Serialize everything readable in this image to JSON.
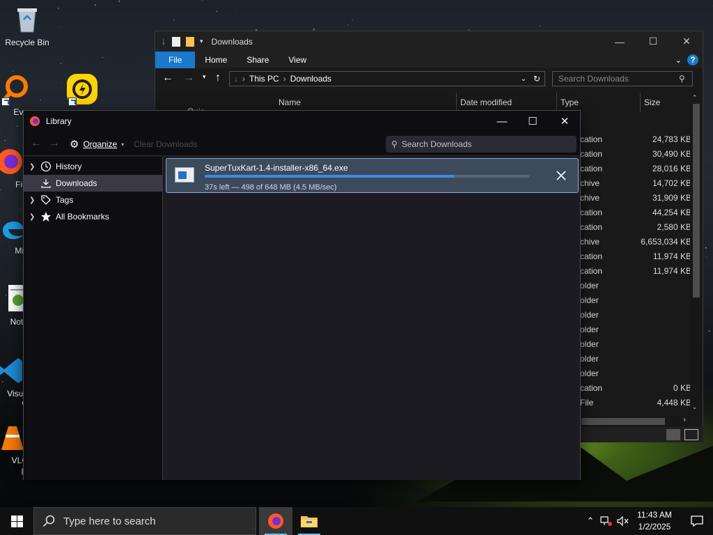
{
  "desktop": {
    "icons": [
      {
        "label": "Recycle Bin"
      },
      {
        "label": "Ever"
      },
      {
        "label": ""
      },
      {
        "label": "Fir"
      },
      {
        "label": "Mic\nE"
      },
      {
        "label": "Note"
      },
      {
        "label": "Visua\nC"
      },
      {
        "label": "VLC\npl"
      }
    ]
  },
  "explorer": {
    "title": "Downloads",
    "ribbon_tabs": [
      "File",
      "Home",
      "Share",
      "View"
    ],
    "breadcrumb": [
      "This PC",
      "Downloads"
    ],
    "search_placeholder": "Search Downloads",
    "columns": {
      "name": "Name",
      "date": "Date modified",
      "type": "Type",
      "size": "Size"
    },
    "partial_row": "Quic",
    "rows": [
      {
        "type": "cation",
        "size": "24,783 KB"
      },
      {
        "type": "cation",
        "size": "30,490 KB"
      },
      {
        "type": "cation",
        "size": "28,016 KB"
      },
      {
        "type": "chive",
        "size": "14,702 KB"
      },
      {
        "type": "chive",
        "size": "31,909 KB"
      },
      {
        "type": "cation",
        "size": "44,254 KB"
      },
      {
        "type": "cation",
        "size": "2,580 KB"
      },
      {
        "type": "chive",
        "size": "6,653,034 KB"
      },
      {
        "type": "cation",
        "size": "11,974 KB"
      },
      {
        "type": "cation",
        "size": "11,974 KB"
      },
      {
        "type": "older",
        "size": ""
      },
      {
        "type": "older",
        "size": ""
      },
      {
        "type": "older",
        "size": ""
      },
      {
        "type": "older",
        "size": ""
      },
      {
        "type": "older",
        "size": ""
      },
      {
        "type": "older",
        "size": ""
      },
      {
        "type": "older",
        "size": ""
      },
      {
        "type": "cation",
        "size": "0 KB"
      },
      {
        "type": "File",
        "size": "4,448 KB"
      }
    ]
  },
  "library": {
    "title": "Library",
    "organize_label": "Organize",
    "clear_label": "Clear Downloads",
    "search_placeholder": "Search Downloads",
    "sidebar": [
      {
        "label": "History",
        "twisty": true,
        "icon": "clock-icon"
      },
      {
        "label": "Downloads",
        "twisty": false,
        "icon": "download-icon",
        "selected": true
      },
      {
        "label": "Tags",
        "twisty": true,
        "icon": "tag-icon"
      },
      {
        "label": "All Bookmarks",
        "twisty": true,
        "icon": "star-icon"
      }
    ],
    "download": {
      "filename": "SuperTuxKart-1.4-installer-x86_64.exe",
      "status": "37s left — 498 of 648 MB (4.5 MB/sec)",
      "progress": 0.768
    }
  },
  "taskbar": {
    "search_placeholder": "Type here to search",
    "time": "11:43 AM",
    "date": "1/2/2025"
  }
}
